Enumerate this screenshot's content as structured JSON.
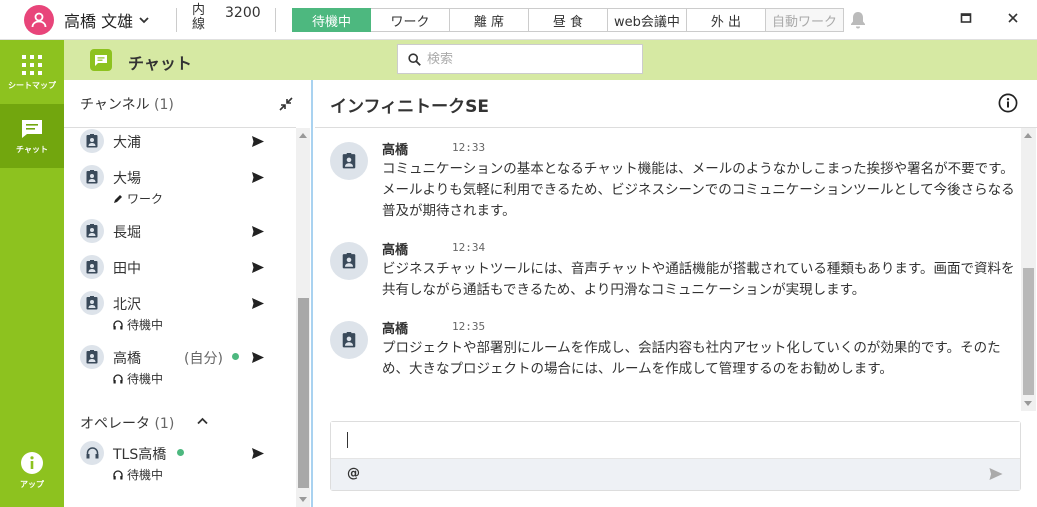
{
  "user": {
    "name": "高橋 文雄"
  },
  "extension": {
    "label": "内線",
    "number": "3200"
  },
  "status_buttons": [
    {
      "label": "待機中"
    },
    {
      "label": "ワーク"
    },
    {
      "label": "離 席"
    },
    {
      "label": "昼 食"
    },
    {
      "label": "web会議中"
    },
    {
      "label": "外 出"
    },
    {
      "label": "自動ワーク"
    }
  ],
  "sidebar": {
    "items": [
      {
        "label": "シートマップ",
        "icon": "grid-icon"
      },
      {
        "label": "チャット",
        "icon": "chat-icon"
      },
      {
        "label": "アップ",
        "icon": "info-icon"
      }
    ]
  },
  "header": {
    "title": "チャット",
    "search_placeholder": "検索"
  },
  "channels": {
    "title": "チャンネル",
    "count": "(1)",
    "items": [
      {
        "name": "大浦",
        "sub": ""
      },
      {
        "name": "大場",
        "sub": "ワーク"
      },
      {
        "name": "長堀",
        "sub": ""
      },
      {
        "name": "田中",
        "sub": ""
      },
      {
        "name": "北沢",
        "sub": "待機中"
      },
      {
        "name": "高橋",
        "self": "(自分)",
        "sub": "待機中"
      }
    ]
  },
  "operators": {
    "title": "オペレータ",
    "count": "(1)",
    "items": [
      {
        "name": "TLS高橋",
        "sub": "待機中"
      }
    ]
  },
  "room": {
    "title": "インフィニトークSE",
    "messages": [
      {
        "name": "高橋",
        "time": "12:33",
        "text": "コミュニケーションの基本となるチャット機能は、メールのようなかしこまった挨拶や署名が不要です。メールよりも気軽に利用できるため、ビジネスシーンでのコミュニケーションツールとして今後さらなる普及が期待されます。"
      },
      {
        "name": "高橋",
        "time": "12:34",
        "text": "ビジネスチャットツールには、音声チャットや通話機能が搭載されている種類もあります。画面で資料を共有しながら通話もできるため、より円滑なコミュニケーションが実現します。"
      },
      {
        "name": "高橋",
        "time": "12:35",
        "text": "プロジェクトや部署別にルームを作成し、会話内容も社内アセット化していくのが効果的です。そのため、大きなプロジェクトの場合には、ルームを作成して管理するのをお勧めします。"
      }
    ]
  },
  "composer": {
    "value": "",
    "mention": "@"
  },
  "colors": {
    "accent": "#8dc21f",
    "header_bg": "#d6e9a3",
    "active_status": "#4db87f",
    "avatar": "#e8457a"
  }
}
